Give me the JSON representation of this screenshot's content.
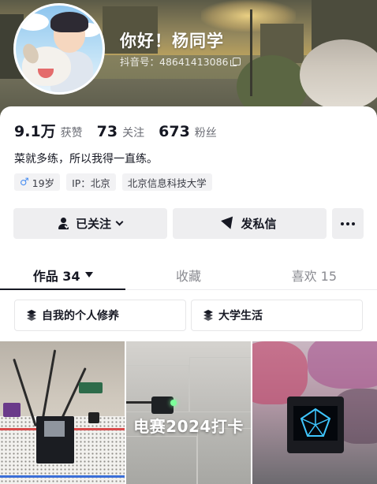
{
  "profile": {
    "name": "你好！杨同学",
    "douyin_id": "抖音号：48641413086"
  },
  "stats": [
    {
      "num": "9.1万",
      "label": "获赞"
    },
    {
      "num": "73",
      "label": "关注"
    },
    {
      "num": "673",
      "label": "粉丝"
    }
  ],
  "bio": "菜就多练，所以我得一直练。",
  "tags": {
    "age": "19岁",
    "ip": "IP：北京",
    "school": "北京信息科技大学"
  },
  "actions": {
    "follow": "已关注",
    "message": "发私信"
  },
  "tabs": [
    {
      "label": "作品 34"
    },
    {
      "label": "收藏"
    },
    {
      "label": "喜欢 15"
    }
  ],
  "collections": [
    {
      "label": "自我的个人修养"
    },
    {
      "label": "大学生活"
    }
  ],
  "videos": [
    {
      "overlay": ""
    },
    {
      "overlay": "电赛2024打卡"
    },
    {
      "overlay": ""
    }
  ],
  "colors": {
    "accent": "#161823",
    "muted": "#8a8b91",
    "tag_bg": "#f2f2f4",
    "button_bg": "#eeeef0",
    "male": "#4a8ff2"
  },
  "icons": [
    "copy-icon",
    "male-icon",
    "user-check-icon",
    "chevron-down-icon",
    "send-icon",
    "more-icon",
    "caret-down-icon",
    "layers-icon"
  ]
}
